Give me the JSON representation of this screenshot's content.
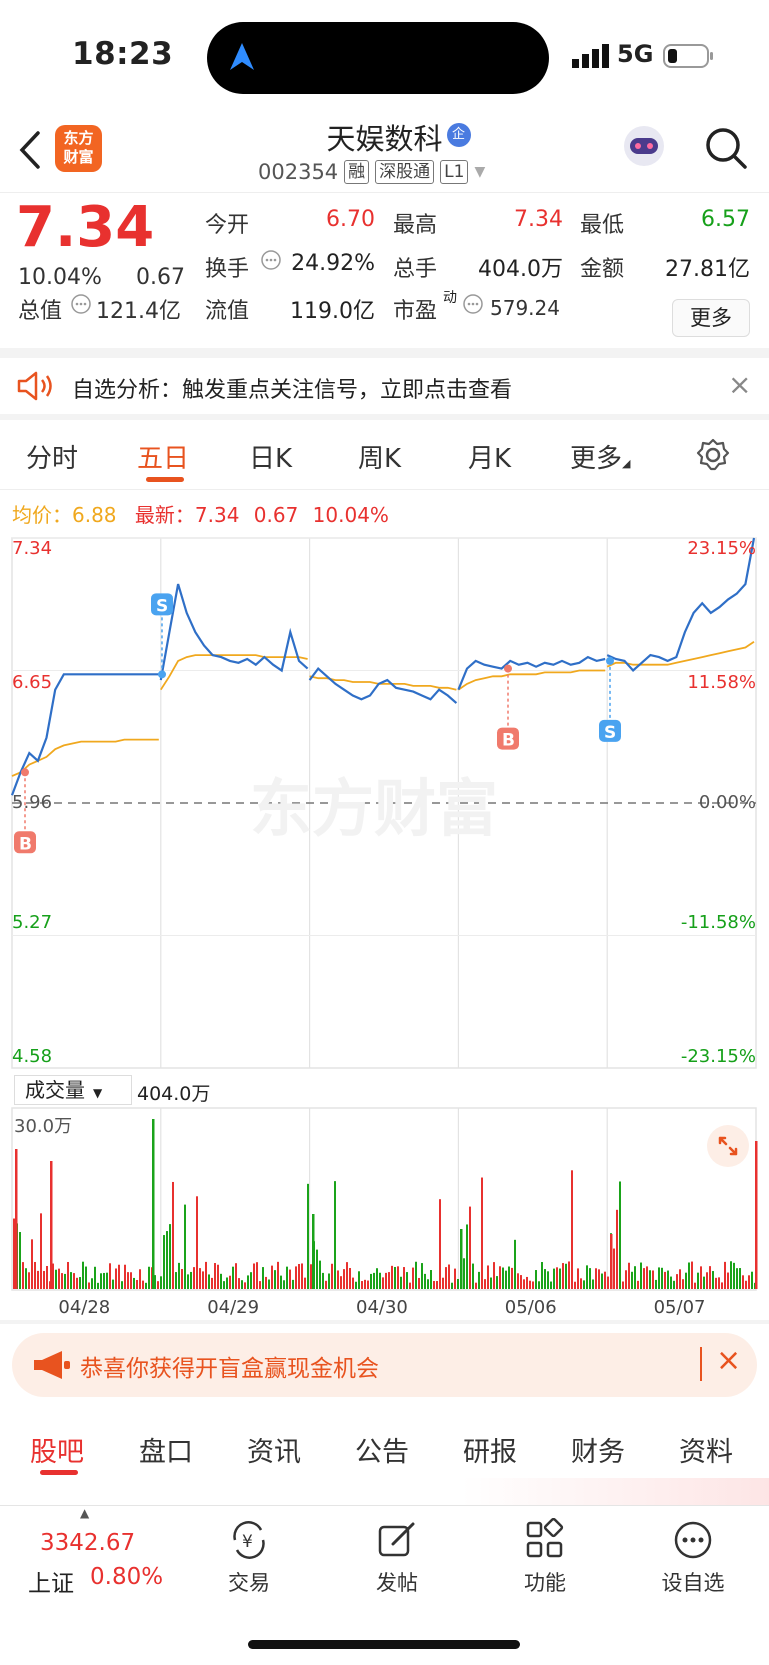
{
  "status": {
    "time": "18:23",
    "network": "5G"
  },
  "header": {
    "logo_line1": "东方",
    "logo_line2": "财富",
    "stock_name": "天娱数科",
    "name_badge": "企",
    "stock_code": "002354",
    "tags": [
      "融",
      "深股通",
      "L1"
    ]
  },
  "quote": {
    "price": "7.34",
    "change_pct": "10.04%",
    "change": "0.67",
    "open_label": "今开",
    "open": "6.70",
    "high_label": "最高",
    "high": "7.34",
    "low_label": "最低",
    "low": "6.57",
    "turnover_label": "换手",
    "turnover": "24.92%",
    "volume_label": "总手",
    "volume": "404.0万",
    "amount_label": "金额",
    "amount": "27.81亿",
    "mktcap_label": "总值",
    "mktcap": "121.4亿",
    "float_label": "流值",
    "float_cap": "119.0亿",
    "pe_label": "市盈",
    "pe_sup": "动",
    "pe": "579.24",
    "more": "更多"
  },
  "alert": {
    "text": "自选分析：触发重点关注信号，立即点击查看"
  },
  "chart_tabs": [
    "分时",
    "五日",
    "日K",
    "周K",
    "月K",
    "更多"
  ],
  "avg": {
    "avg_label": "均价：",
    "avg_value": "6.88",
    "last_label": "最新：",
    "last_value": "7.34",
    "last_change": "0.67",
    "last_pct": "10.04%"
  },
  "volume_section": {
    "selector": "成交量",
    "total": "404.0万",
    "axis_max": "30.0万"
  },
  "watermark": "东方财富",
  "chart_data": {
    "type": "line",
    "title": "",
    "x_dates": [
      "04/28",
      "04/29",
      "04/30",
      "05/06",
      "05/07"
    ],
    "ylim": [
      4.58,
      7.34
    ],
    "y_ticks_left": [
      "7.34",
      "6.65",
      "5.96",
      "5.27",
      "4.58"
    ],
    "y_ticks_right": [
      "23.15%",
      "11.58%",
      "0.00%",
      "-11.58%",
      "-23.15%"
    ],
    "preclose": 5.96,
    "series": [
      {
        "name": "价格",
        "color": "#2f6fc7",
        "values": [
          6.0,
          6.12,
          6.22,
          6.18,
          6.3,
          6.55,
          6.63,
          6.63,
          6.63,
          6.63,
          6.63,
          6.63,
          6.63,
          6.63,
          6.63,
          6.63,
          6.63,
          6.63,
          6.6,
          6.85,
          7.1,
          6.95,
          6.85,
          6.78,
          6.73,
          6.72,
          6.7,
          6.69,
          6.71,
          6.68,
          6.72,
          6.68,
          6.65,
          6.85,
          6.7,
          6.66,
          6.6,
          6.66,
          6.62,
          6.58,
          6.55,
          6.52,
          6.5,
          6.52,
          6.58,
          6.6,
          6.56,
          6.55,
          6.54,
          6.52,
          6.5,
          6.55,
          6.52,
          6.48,
          6.55,
          6.66,
          6.7,
          6.68,
          6.67,
          6.66,
          6.7,
          6.68,
          6.69,
          6.67,
          6.69,
          6.68,
          6.7,
          6.68,
          6.69,
          6.72,
          6.7,
          6.71,
          6.73,
          6.71,
          6.7,
          6.65,
          6.69,
          6.73,
          6.72,
          6.7,
          6.72,
          6.85,
          6.95,
          7.0,
          6.95,
          6.98,
          7.02,
          7.05,
          7.1,
          7.34
        ]
      },
      {
        "name": "均价",
        "color": "#f0a81e",
        "values": [
          6.1,
          6.12,
          6.16,
          6.18,
          6.2,
          6.24,
          6.26,
          6.27,
          6.28,
          6.28,
          6.28,
          6.28,
          6.28,
          6.29,
          6.29,
          6.29,
          6.29,
          6.29,
          6.55,
          6.62,
          6.7,
          6.72,
          6.73,
          6.73,
          6.73,
          6.73,
          6.73,
          6.73,
          6.73,
          6.73,
          6.72,
          6.72,
          6.72,
          6.72,
          6.72,
          6.71,
          6.62,
          6.61,
          6.61,
          6.6,
          6.6,
          6.59,
          6.59,
          6.59,
          6.58,
          6.58,
          6.58,
          6.58,
          6.57,
          6.57,
          6.57,
          6.56,
          6.56,
          6.55,
          6.55,
          6.58,
          6.6,
          6.61,
          6.62,
          6.62,
          6.63,
          6.63,
          6.63,
          6.63,
          6.64,
          6.64,
          6.64,
          6.64,
          6.65,
          6.65,
          6.65,
          6.65,
          6.67,
          6.69,
          6.69,
          6.68,
          6.68,
          6.68,
          6.68,
          6.68,
          6.69,
          6.7,
          6.71,
          6.72,
          6.73,
          6.74,
          6.75,
          6.76,
          6.77,
          6.8
        ]
      }
    ],
    "volume_ylim": [
      0,
      30
    ],
    "trade_markers": [
      "B",
      "S",
      "B",
      "S"
    ]
  },
  "banner": {
    "text": "恭喜你获得开盲盒赢现金机会"
  },
  "bottom_tabs": [
    "股吧",
    "盘口",
    "资讯",
    "公告",
    "研报",
    "财务",
    "资料"
  ],
  "nav": {
    "index_value": "3342.67",
    "index_name": "上证",
    "index_pct": "0.80%",
    "items": [
      "交易",
      "发帖",
      "功能",
      "设自选"
    ]
  }
}
